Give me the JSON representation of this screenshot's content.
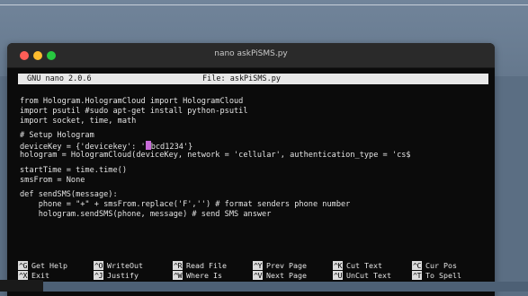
{
  "window": {
    "title": "nano askPiSMS.py"
  },
  "nano": {
    "version": "GNU nano 2.0.6",
    "file_label": "File: askPiSMS.py"
  },
  "code": {
    "l1": "from Hologram.HologramCloud import HologramCloud",
    "l2": "import psutil #sudo apt-get install python-psutil",
    "l3": "import socket, time, math",
    "l4": "# Setup Hologram",
    "l5a": "deviceKey = {'devicekey': '",
    "l5b": "bcd1234'}",
    "l6": "hologram = HologramCloud(deviceKey, network = 'cellular', authentication_type = 'cs$",
    "l7": "startTime = time.time()",
    "l8": "smsFrom = None",
    "l9": "def sendSMS(message):",
    "l10": "    phone = \"+\" + smsFrom.replace('F','') # format senders phone number",
    "l11": "    hologram.sendSMS(phone, message) # send SMS answer"
  },
  "shortcuts": {
    "row1": [
      {
        "key": "^G",
        "label": "Get Help"
      },
      {
        "key": "^O",
        "label": "WriteOut"
      },
      {
        "key": "^R",
        "label": "Read File"
      },
      {
        "key": "^Y",
        "label": "Prev Page"
      },
      {
        "key": "^K",
        "label": "Cut Text"
      },
      {
        "key": "^C",
        "label": "Cur Pos"
      }
    ],
    "row2": [
      {
        "key": "^X",
        "label": "Exit"
      },
      {
        "key": "^J",
        "label": "Justify"
      },
      {
        "key": "^W",
        "label": "Where Is"
      },
      {
        "key": "^V",
        "label": "Next Page"
      },
      {
        "key": "^U",
        "label": "UnCut Text"
      },
      {
        "key": "^T",
        "label": "To Spell"
      }
    ]
  },
  "colors": {
    "close": "#fd5e57",
    "minimize": "#febc2e",
    "zoom": "#27c840",
    "cursor": "#c86bd9"
  }
}
